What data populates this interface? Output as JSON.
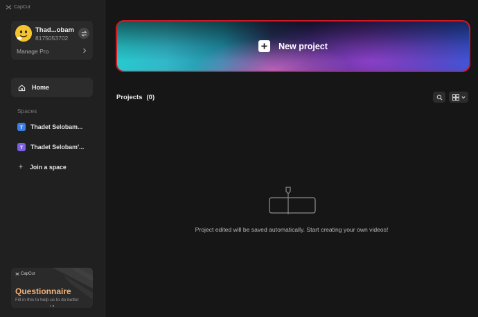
{
  "app": {
    "name": "CapCut"
  },
  "account": {
    "name": "Thad...obam",
    "id": "8175053702",
    "manage_label": "Manage Pro"
  },
  "nav": {
    "home_label": "Home"
  },
  "spaces": {
    "label": "Spaces",
    "items": [
      {
        "badge": "T",
        "name": "Thadet Selobam...",
        "color": "#3d7fe0"
      },
      {
        "badge": "T",
        "name": "Thadet Selobam'...",
        "color": "#7b5fe0"
      }
    ],
    "join_label": "Join a space"
  },
  "banner": {
    "logo": "CapCut",
    "title": "Questionnaire",
    "subtitle": "Fill in this to help us to do better"
  },
  "main": {
    "new_project_label": "New project",
    "projects_label": "Projects",
    "projects_count": "(0)",
    "empty_message": "Project edited will be saved automatically. Start creating your own videos!"
  },
  "colors": {
    "accent": "#2ec7e6",
    "highlight_border": "#d41620",
    "banner_title": "#f2b27a"
  },
  "icons": [
    "capcut-logo-icon",
    "switch-account-icon",
    "chevron-right-icon",
    "home-icon",
    "plus-icon",
    "feedback-icon",
    "settings-icon",
    "minimize-icon",
    "maximize-icon",
    "close-icon",
    "search-icon",
    "grid-view-icon",
    "chevron-down-icon"
  ]
}
